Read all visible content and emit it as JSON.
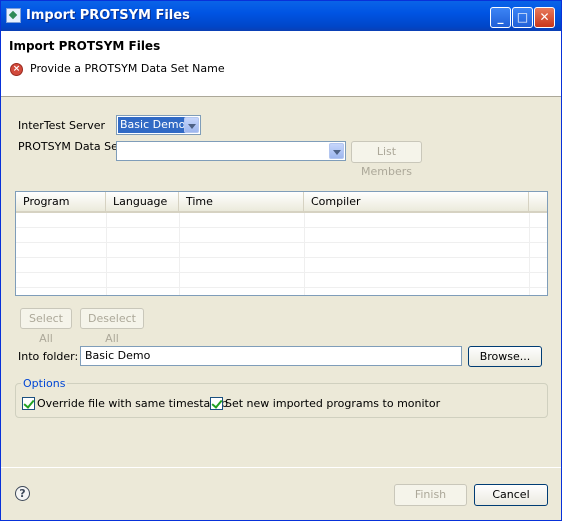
{
  "window": {
    "title": "Import PROTSYM Files"
  },
  "header": {
    "title": "Import PROTSYM Files",
    "message": "Provide a PROTSYM Data Set Name"
  },
  "form": {
    "server_label": "InterTest Server",
    "server_value": "Basic Demo",
    "dataset_label": "PROTSYM Data Set",
    "dataset_value": "",
    "list_members_label": "List Members"
  },
  "table": {
    "columns": [
      "Program",
      "Language",
      "Time",
      "Compiler"
    ],
    "rows": []
  },
  "selection": {
    "select_all_label": "Select All",
    "deselect_all_label": "Deselect All"
  },
  "folder": {
    "label": "Into folder:",
    "value": "Basic Demo",
    "browse_label": "Browse..."
  },
  "options": {
    "title": "Options",
    "override_label": "Override file with same timestamp",
    "override_checked": true,
    "monitor_label": "Set new imported programs to monitor",
    "monitor_checked": true
  },
  "footer": {
    "finish_label": "Finish",
    "cancel_label": "Cancel"
  },
  "icons": {
    "app": "eclipse-app-icon",
    "error": "error-icon",
    "help": "help-icon"
  }
}
